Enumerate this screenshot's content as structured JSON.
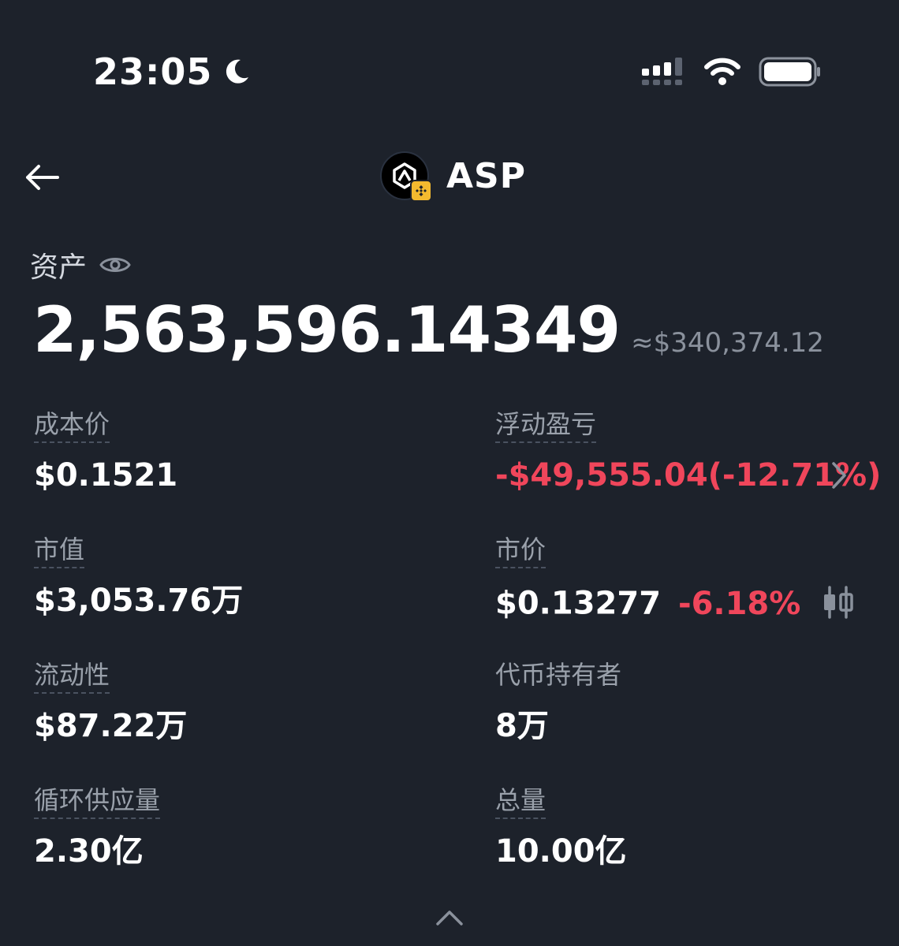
{
  "status_bar": {
    "time": "23:05",
    "icons": [
      "moon-icon",
      "signal-icon",
      "wifi-icon",
      "battery-icon"
    ]
  },
  "header": {
    "back_icon": "arrow-left-icon",
    "token_symbol": "ASP",
    "chain_badge": "bnb-chain-icon"
  },
  "assets": {
    "label": "资产",
    "balance": "2,563,596.14349",
    "usd_value": "≈$340,374.12"
  },
  "stats": {
    "cost_price": {
      "label": "成本价",
      "value": "$0.1521"
    },
    "floating_pnl": {
      "label": "浮动盈亏",
      "value": "-$49,555.04(-12.71%)"
    },
    "market_cap": {
      "label": "市值",
      "value": "$3,053.76万"
    },
    "market_price": {
      "label": "市价",
      "value": "$0.13277",
      "change": "-6.18%"
    },
    "liquidity": {
      "label": "流动性",
      "value": "$87.22万"
    },
    "holders": {
      "label": "代币持有者",
      "value": "8万"
    },
    "circulating_supply": {
      "label": "循环供应量",
      "value": "2.30亿"
    },
    "total_supply": {
      "label": "总量",
      "value": "10.00亿"
    }
  },
  "colors": {
    "background": "#1d222b",
    "negative": "#f0465b",
    "muted": "#9aa1ab"
  }
}
